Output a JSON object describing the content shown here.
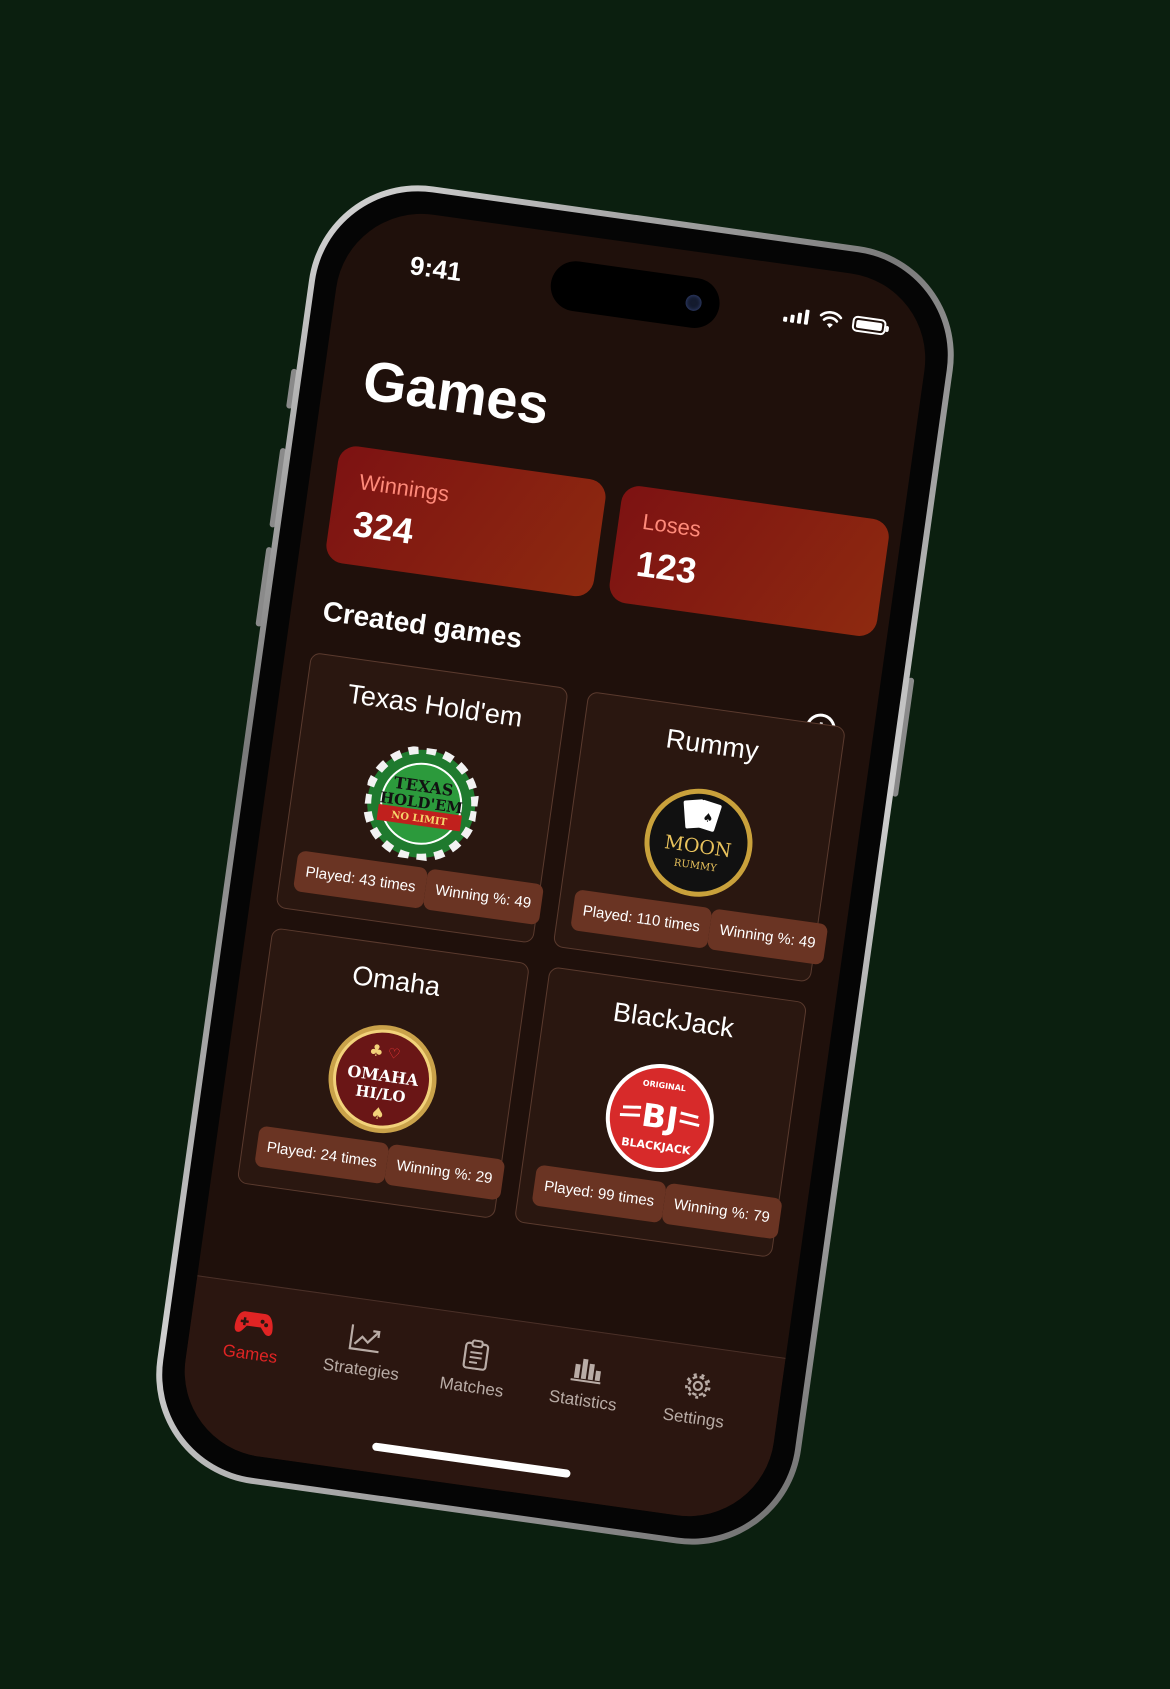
{
  "status_bar": {
    "time": "9:41"
  },
  "header": {
    "title": "Games"
  },
  "stats": {
    "winnings": {
      "label": "Winnings",
      "value": "324"
    },
    "loses": {
      "label": "Loses",
      "value": "123"
    }
  },
  "created_games": {
    "title": "Created games",
    "games": [
      {
        "name": "Texas Hold'em",
        "played": "Played: 43 times",
        "winning": "Winning %: 49",
        "logo_text": [
          "TEXAS",
          "HOLD'EM",
          "NO LIMIT"
        ]
      },
      {
        "name": "Rummy",
        "played": "Played: 110 times",
        "winning": "Winning %: 49",
        "logo_text": [
          "MOON",
          "RUMMY"
        ]
      },
      {
        "name": "Omaha",
        "played": "Played: 24 times",
        "winning": "Winning %: 29",
        "logo_text": [
          "OMAHA",
          "HI/LO"
        ]
      },
      {
        "name": "BlackJack",
        "played": "Played: 99 times",
        "winning": "Winning %: 79",
        "logo_text": [
          "ORIGINAL",
          "BJ",
          "BLACKJACK"
        ]
      }
    ]
  },
  "tabbar": {
    "items": [
      {
        "label": "Games",
        "icon": "gamepad-icon",
        "active": true
      },
      {
        "label": "Strategies",
        "icon": "chart-line-icon"
      },
      {
        "label": "Matches",
        "icon": "clipboard-icon"
      },
      {
        "label": "Statistics",
        "icon": "bar-chart-icon"
      },
      {
        "label": "Settings",
        "icon": "gear-icon"
      }
    ]
  },
  "colors": {
    "background": "#0b1f0f",
    "screen": "#1f100b",
    "accent": "#e02424",
    "card": "#2a1710",
    "pill": "#6a3423"
  }
}
